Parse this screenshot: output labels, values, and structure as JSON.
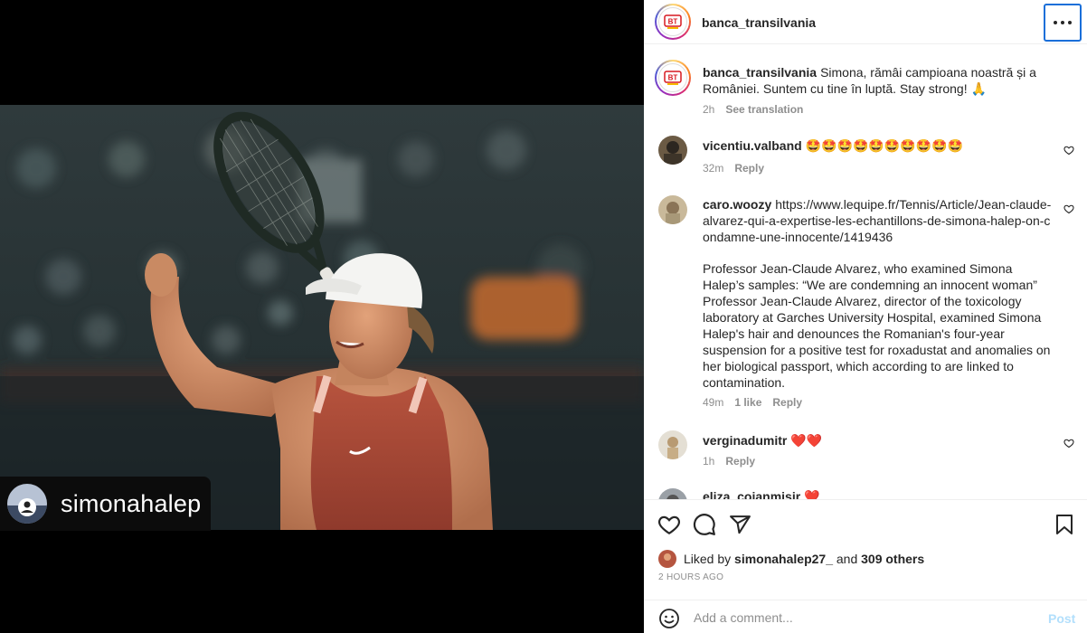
{
  "post": {
    "author": "banca_transilvania",
    "logo_text": "BT",
    "tagged_user": "simonahalep"
  },
  "caption": {
    "username": "banca_transilvania",
    "text": "Simona, rămâi campioana noastră și a României. Suntem cu tine în luptă. Stay strong! 🙏",
    "time": "2h",
    "translate": "See translation"
  },
  "comments": [
    {
      "username": "vicentiu.valband",
      "text": "🤩🤩🤩🤩🤩🤩🤩🤩🤩🤩",
      "time": "32m",
      "likes": "",
      "reply": "Reply"
    },
    {
      "username": "caro.woozy",
      "text": "https://www.lequipe.fr/Tennis/Article/Jean-claude-alvarez-qui-a-expertise-les-echantillons-de-simona-halep-on-condamne-une-innocente/1419436",
      "text2": "Professor Jean-Claude Alvarez, who examined Simona Halep’s samples: “We are condemning an innocent woman”\nProfessor Jean-Claude Alvarez, director of the toxicology laboratory at Garches University Hospital, examined Simona Halep's hair and denounces the Romanian's four-year suspension for a positive test for roxadustat and anomalies on her biological passport, which according to are linked to contamination.",
      "time": "49m",
      "likes": "1 like",
      "reply": "Reply"
    },
    {
      "username": "verginadumitr",
      "text": "❤️❤️",
      "time": "1h",
      "likes": "",
      "reply": "Reply"
    },
    {
      "username": "eliza_cojanmisir",
      "text": "❤️"
    }
  ],
  "likes": {
    "prefix": "Liked by",
    "user": "simonahalep27_",
    "mid": "and",
    "others": "309 others"
  },
  "timestamp": "2 HOURS AGO",
  "add_comment": {
    "placeholder": "Add a comment...",
    "post_label": "Post"
  },
  "colors": {
    "accent_blue": "#1a6fd9",
    "post_disabled": "#b2dffc",
    "meta_gray": "#8e8e8e",
    "bt_red": "#d71920",
    "bt_yellow": "#f6b800"
  },
  "icons": [
    "more-icon",
    "heart-icon",
    "comment-icon",
    "share-icon",
    "bookmark-icon",
    "emoji-icon",
    "like-heart-icon"
  ]
}
